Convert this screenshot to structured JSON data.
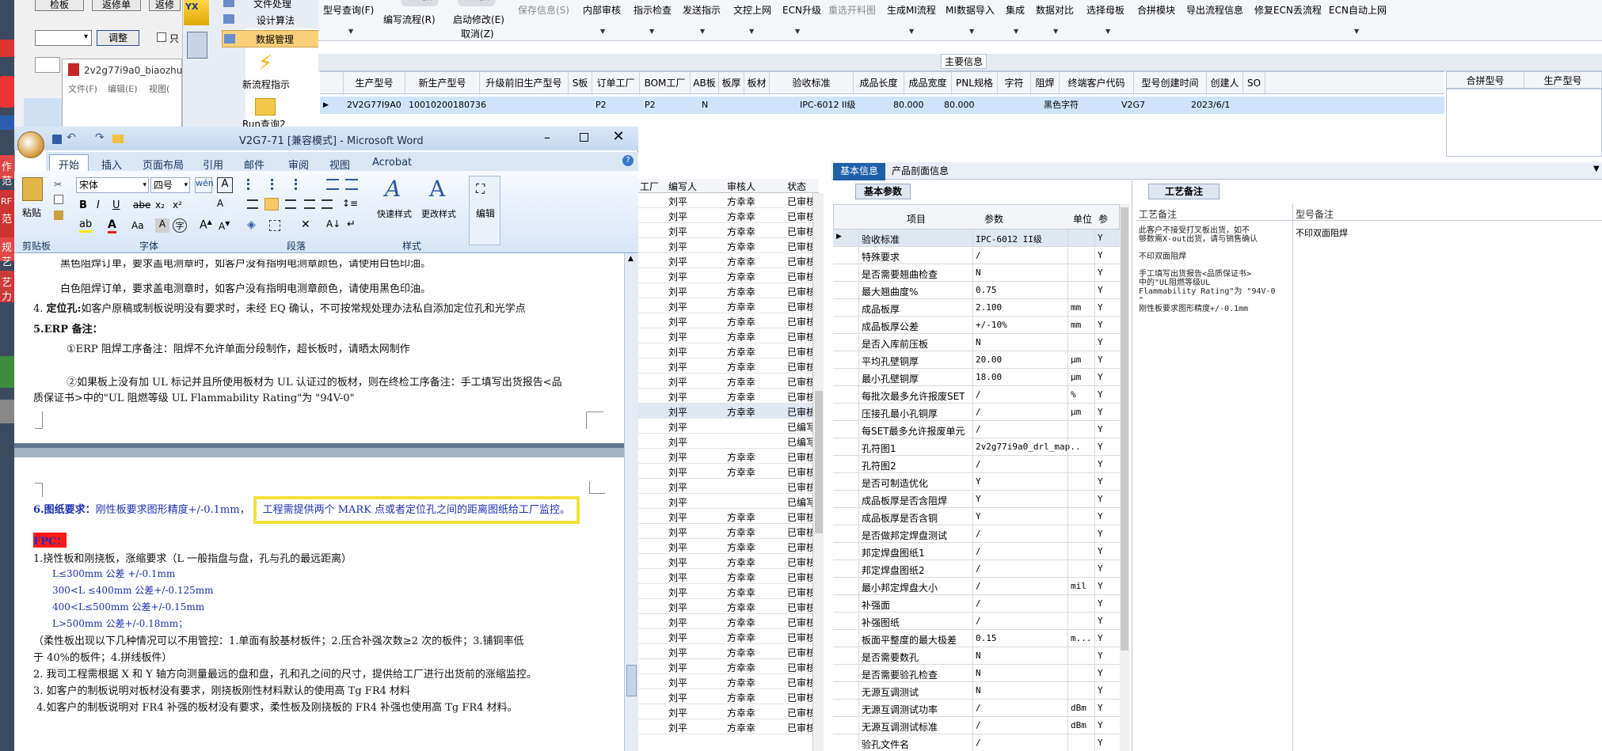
{
  "topleft": {
    "btn1": "检板",
    "btn2": "返修单",
    "btn3": "返修",
    "adjust_btn": "调整",
    "check_label": "只"
  },
  "nav": {
    "items": [
      "文件处理",
      "设计算法",
      "数据管理"
    ],
    "new_flow": "新流程指示",
    "query": "Run查询2"
  },
  "pdf_window": {
    "title": "2v2g77i9a0_biaozhu",
    "menu": [
      "文件(F)",
      "编辑(E)",
      "视图("
    ]
  },
  "toolbar": {
    "items": [
      {
        "label": "型号查询(F)",
        "disabled": false
      },
      {
        "label": "编写流程(R)",
        "disabled": false
      },
      {
        "label": "启动修改(E)",
        "disabled": false
      },
      {
        "label": "保存信息(S)",
        "disabled": true
      },
      {
        "label": "内部审核",
        "disabled": false
      },
      {
        "label": "指示检查",
        "disabled": false
      },
      {
        "label": "发送指示",
        "disabled": false
      },
      {
        "label": "文控上网",
        "disabled": false
      },
      {
        "label": "ECN升级",
        "disabled": false
      },
      {
        "label": "重选开料图",
        "disabled": true
      },
      {
        "label": "生成MI流程",
        "disabled": false
      },
      {
        "label": "MI数据导入",
        "disabled": false
      },
      {
        "label": "集成",
        "disabled": false
      },
      {
        "label": "数据对比",
        "disabled": false
      },
      {
        "label": "选择母板",
        "disabled": false
      },
      {
        "label": "合拼模块",
        "disabled": false
      },
      {
        "label": "导出流程信息",
        "disabled": false
      },
      {
        "label": "修复ECN丢流程",
        "disabled": false
      },
      {
        "label": "ECN自动上网",
        "disabled": false
      }
    ],
    "toggle_off": "OFF",
    "cancel_label": "取消(Z)"
  },
  "main_info": {
    "title": "主要信息",
    "columns": [
      "生产型号",
      "新生产型号",
      "升级前旧生产型号",
      "S板",
      "订单工厂",
      "BOM工厂",
      "AB板",
      "板厚",
      "板材",
      "验收标准",
      "成品长度",
      "成品宽度",
      "PNL规格",
      "字符",
      "阻焊",
      "终端客户代码",
      "型号创建时间",
      "创建人",
      "SO"
    ],
    "row": [
      "2V2G77I9A0",
      "10010200180736",
      "",
      "",
      "P2",
      "P2",
      "N",
      "",
      "",
      "IPC-6012 II级",
      "80.000",
      "80.000",
      "",
      "黑色字符",
      "",
      "V2G7",
      "2023/6/1",
      "",
      ""
    ],
    "side_columns": [
      "合拼型号",
      "生产型号"
    ]
  },
  "word": {
    "title": "V2G7-71 [兼容模式] - Microsoft Word",
    "tabs": [
      "开始",
      "插入",
      "页面布局",
      "引用",
      "邮件",
      "审阅",
      "视图",
      "Acrobat"
    ],
    "font_name": "宋体",
    "font_size": "四号",
    "groups": [
      "剪贴板",
      "字体",
      "段落",
      "样式"
    ],
    "paste": "粘贴",
    "quick_style": "快速样式",
    "change_style": "更改样式",
    "edit": "编辑",
    "doc": {
      "l1": "黑色阻焊订单，要求盖电测章时，如客户没有指明电测章颜色，请使用白色印油。",
      "l2": "白色阻焊订单，要求盖电测章时，如客户没有指明电测章颜色，请使用黑色印油。",
      "l3_num": "4.",
      "l3_bold": "定位孔:",
      "l3_text": "如客户原稿或制板说明没有要求时，未经 EQ 确认，不可按常规处理办法私自添加定位孔和光学点",
      "l4": "5.ERP 备注：",
      "l5": "①ERP 阻焊工序备注：阻焊不允许单面分段制作，超长板时，请晒太网制作",
      "l6": "②如果板上没有加 UL 标记并且所使用板材为 UL 认证过的板材，则在终检工序备注：手工填写出货报告<品",
      "l7": "质保证书>中的\"UL 阻燃等级 UL Flammability Rating\"为 \"94V-0\"",
      "l8_bold": "6.图纸要求：",
      "l8_text": "刚性板要求图形精度+/-0.1mm，",
      "l8_highlight": "工程需提供两个 MARK 点或者定位孔之间的距离图纸给工厂监控。",
      "l9": "FPC：",
      "l10": "1.挠性板和刚挠板，涨缩要求（L 一般指盘与盘，孔与孔的最远距离）",
      "l11": "L≤300mm 公差 +/-0.1mm",
      "l12": "300<L ≤400mm 公差+/-0.125mm",
      "l13": "400<L≤500mm 公差+/-0.15mm",
      "l14": "L>500mm 公差+/-0.18mm；",
      "l15": "（柔性板出现以下几种情况可以不用管控：1.单面有胶基材板件；2.压合补强次数≥2 次的板件；3.铺铜率低",
      "l16": "于 40%的板件；4.拼线板件）",
      "l17": "2.   我司工程需根据 X 和 Y 轴方向测量最远的盘和盘，孔和孔之间的尺寸，提供给工厂进行出货前的涨缩监控。",
      "l18": "3. 如客户的制板说明对板材没有要求，刚挠板刚性材料默认的使用高 Tg FR4 材料",
      "l19": "4.如客户的制板说明对 FR4 补强的板材没有要求，柔性板及刚挠板的 FR4 补强也使用高 Tg FR4 材料。"
    }
  },
  "grid": {
    "columns": [
      "工厂",
      "编写人",
      "审核人",
      "状态"
    ],
    "rows": [
      [
        "刘平",
        "方幸幸",
        "已审核"
      ],
      [
        "刘平",
        "方幸幸",
        "已审核"
      ],
      [
        "刘平",
        "方幸幸",
        "已审核"
      ],
      [
        "刘平",
        "方幸幸",
        "已审核"
      ],
      [
        "刘平",
        "方幸幸",
        "已审核"
      ],
      [
        "刘平",
        "方幸幸",
        "已审核"
      ],
      [
        "刘平",
        "方幸幸",
        "已审核"
      ],
      [
        "刘平",
        "方幸幸",
        "已审核"
      ],
      [
        "刘平",
        "方幸幸",
        "已审核"
      ],
      [
        "刘平",
        "方幸幸",
        "已审核"
      ],
      [
        "刘平",
        "方幸幸",
        "已审核"
      ],
      [
        "刘平",
        "方幸幸",
        "已审核"
      ],
      [
        "刘平",
        "方幸幸",
        "已审核"
      ],
      [
        "刘平",
        "方幸幸",
        "已审核"
      ],
      [
        "刘平",
        "方幸幸",
        "已审核"
      ],
      [
        "刘平",
        "",
        "已编写"
      ],
      [
        "刘平",
        "",
        "已编写"
      ],
      [
        "刘平",
        "方幸幸",
        "已审核"
      ],
      [
        "刘平",
        "方幸幸",
        "已审核"
      ],
      [
        "刘平",
        "",
        "已审核"
      ],
      [
        "刘平",
        "",
        "已编写"
      ],
      [
        "刘平",
        "方幸幸",
        "已审核"
      ],
      [
        "刘平",
        "方幸幸",
        "已审核"
      ],
      [
        "刘平",
        "方幸幸",
        "已审核"
      ],
      [
        "刘平",
        "方幸幸",
        "已审核"
      ],
      [
        "刘平",
        "方幸幸",
        "已审核"
      ],
      [
        "刘平",
        "方幸幸",
        "已审核"
      ],
      [
        "刘平",
        "方幸幸",
        "已审核"
      ],
      [
        "刘平",
        "方幸幸",
        "已审核"
      ],
      [
        "刘平",
        "方幸幸",
        "已审核"
      ],
      [
        "刘平",
        "方幸幸",
        "已审核"
      ],
      [
        "刘平",
        "方幸幸",
        "已审核"
      ],
      [
        "刘平",
        "方幸幸",
        "已审核"
      ],
      [
        "刘平",
        "方幸幸",
        "已审核"
      ],
      [
        "刘平",
        "方幸幸",
        "已审核"
      ],
      [
        "刘平",
        "方幸幸",
        "已审核"
      ]
    ]
  },
  "info_tabs": [
    "基本信息",
    "产品剖面信息"
  ],
  "basic_params": {
    "tab": "基本参数",
    "columns": [
      "项目",
      "参数",
      "单位",
      "参"
    ],
    "rows": [
      [
        "验收标准",
        "IPC-6012 II级",
        "",
        "Y"
      ],
      [
        "特殊要求",
        "/",
        "",
        "Y"
      ],
      [
        "是否需要翘曲检查",
        "N",
        "",
        "Y"
      ],
      [
        "最大翘曲度%",
        "0.75",
        "",
        "Y"
      ],
      [
        "成品板厚",
        "2.100",
        "mm",
        "Y"
      ],
      [
        "成品板厚公差",
        "+/-10%",
        "mm",
        "Y"
      ],
      [
        "是否入库前压板",
        "N",
        "",
        "Y"
      ],
      [
        "平均孔壁铜厚",
        "20.00",
        "μm",
        "Y"
      ],
      [
        "最小孔壁铜厚",
        "18.00",
        "μm",
        "Y"
      ],
      [
        "每批次最多允许报废SET",
        "/",
        "%",
        "Y"
      ],
      [
        "压接孔最小孔铜厚",
        "/",
        "μm",
        "Y"
      ],
      [
        "每SET最多允许报废单元",
        "/",
        "",
        "Y"
      ],
      [
        "孔符图1",
        "2v2g77i9a0_drl_map...",
        "",
        "Y"
      ],
      [
        "孔符图2",
        "/",
        "",
        "Y"
      ],
      [
        "是否可制造优化",
        "Y",
        "",
        "Y"
      ],
      [
        "成品板厚是否含阻焊",
        "Y",
        "",
        "Y"
      ],
      [
        "成品板厚是否含铜",
        "Y",
        "",
        "Y"
      ],
      [
        "是否做邦定焊盘测试",
        "/",
        "",
        "Y"
      ],
      [
        "邦定焊盘图纸1",
        "/",
        "",
        "Y"
      ],
      [
        "邦定焊盘图纸2",
        "/",
        "",
        "Y"
      ],
      [
        "最小邦定焊盘大小",
        "/",
        "mil",
        "Y"
      ],
      [
        "补强面",
        "/",
        "",
        "Y"
      ],
      [
        "补强图纸",
        "/",
        "",
        "Y"
      ],
      [
        "板面平整度的最大极差",
        "0.15",
        "m...",
        "Y"
      ],
      [
        "是否需要数孔",
        "N",
        "",
        "Y"
      ],
      [
        "是否需要验孔检查",
        "N",
        "",
        "Y"
      ],
      [
        "无源互调测试",
        "N",
        "",
        "Y"
      ],
      [
        "无源互调测试功率",
        "/",
        "dBm",
        "Y"
      ],
      [
        "无源互调测试标准",
        "/",
        "dBm",
        "Y"
      ],
      [
        "验孔文件名",
        "/",
        "",
        "Y"
      ]
    ]
  },
  "process_notes": {
    "tab": "工艺备注",
    "col1": "工艺备注",
    "col2": "型号备注",
    "note_lines": [
      "此客户不接受打叉板出货，如不",
      "够数需X-out出货，请与销售确认",
      "",
      "不印双面阻焊",
      "",
      "手工填写出货报告<品质保证书>",
      "中的\"UL阻燃等级UL",
      "Flammability Rating\"为 \"94V-0",
      "\"",
      "刚性板要求图形精度+/-0.1mm"
    ],
    "model_note": "不印双面阻焊"
  },
  "taskbar": {
    "labels": [
      "作",
      "范",
      "RF",
      "范",
      "艺",
      "规",
      "艺",
      "力"
    ]
  }
}
